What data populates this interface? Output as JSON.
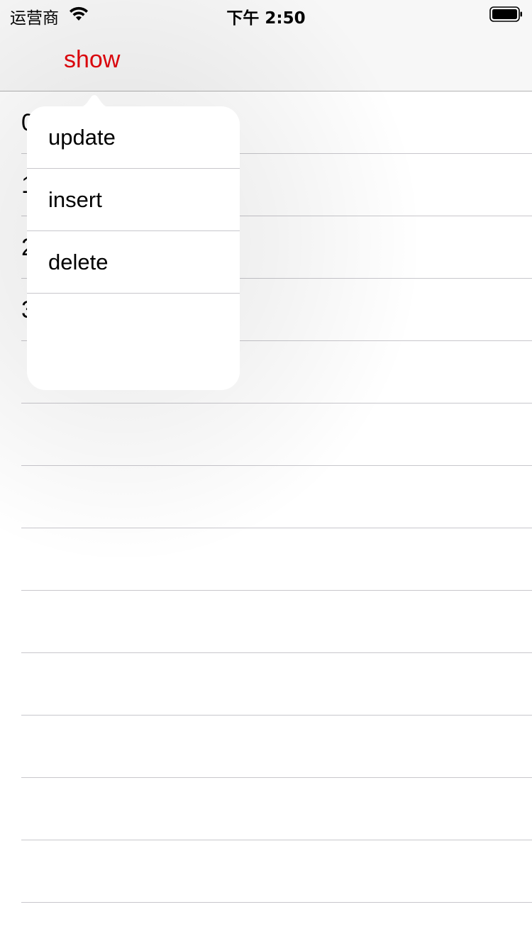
{
  "status_bar": {
    "carrier": "运营商",
    "time": "下午 2:50",
    "icons": [
      "wifi-icon",
      "battery-icon"
    ]
  },
  "nav_bar": {
    "show_label": "show",
    "accent_color": "#e3050d"
  },
  "table": {
    "rows": [
      {
        "label": "0"
      },
      {
        "label": "1"
      },
      {
        "label": "2"
      },
      {
        "label": "3"
      },
      {
        "label": ""
      },
      {
        "label": ""
      },
      {
        "label": ""
      },
      {
        "label": ""
      },
      {
        "label": ""
      },
      {
        "label": ""
      },
      {
        "label": ""
      },
      {
        "label": ""
      },
      {
        "label": ""
      }
    ]
  },
  "popover": {
    "items": [
      {
        "label": "update"
      },
      {
        "label": "insert"
      },
      {
        "label": "delete"
      },
      {
        "label": ""
      }
    ]
  }
}
